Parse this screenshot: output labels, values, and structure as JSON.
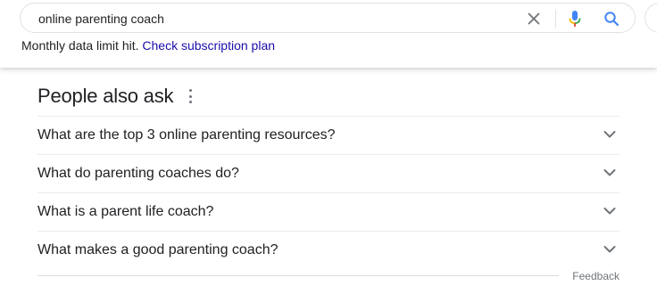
{
  "search": {
    "query": "online parenting coach"
  },
  "notice": {
    "message": "Monthly data limit hit.",
    "link_label": "Check subscription plan"
  },
  "people_also_ask": {
    "title": "People also ask",
    "questions": [
      "What are the top 3 online parenting resources?",
      "What do parenting coaches do?",
      "What is a parent life coach?",
      "What makes a good parenting coach?"
    ]
  },
  "footer": {
    "feedback_label": "Feedback"
  },
  "colors": {
    "link": "#1a0dab",
    "search_icon": "#4285f4",
    "mic_blue": "#4285f4",
    "mic_red": "#ea4335",
    "mic_yellow": "#fbbc04",
    "mic_green": "#34a853"
  },
  "icons": [
    "clear-icon",
    "microphone-icon",
    "search-icon",
    "more-options-icon",
    "chevron-down-icon"
  ]
}
